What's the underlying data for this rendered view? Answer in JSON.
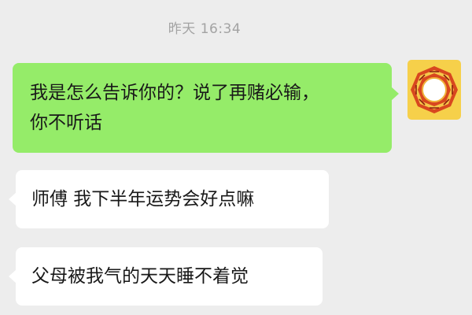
{
  "chat": {
    "timestamp": "昨天 16:34",
    "messages": [
      {
        "direction": "outgoing",
        "lines": [
          "我是怎么告诉你的？说了再赌必输，",
          "你不听话"
        ]
      },
      {
        "direction": "incoming",
        "text": "师傅 我下半年运势会好点嘛"
      },
      {
        "direction": "incoming",
        "text": "父母被我气的天天睡不着觉"
      }
    ]
  },
  "avatar": {
    "icon": "bagua-icon",
    "colors": {
      "background": "#f6d04a",
      "frame": "#d8471f",
      "center": "#ffffff"
    }
  },
  "theme": {
    "chat_bg": "#ededed",
    "outgoing_bubble": "#95ec69",
    "incoming_bubble": "#ffffff",
    "timestamp_color": "#a3a3a3"
  }
}
